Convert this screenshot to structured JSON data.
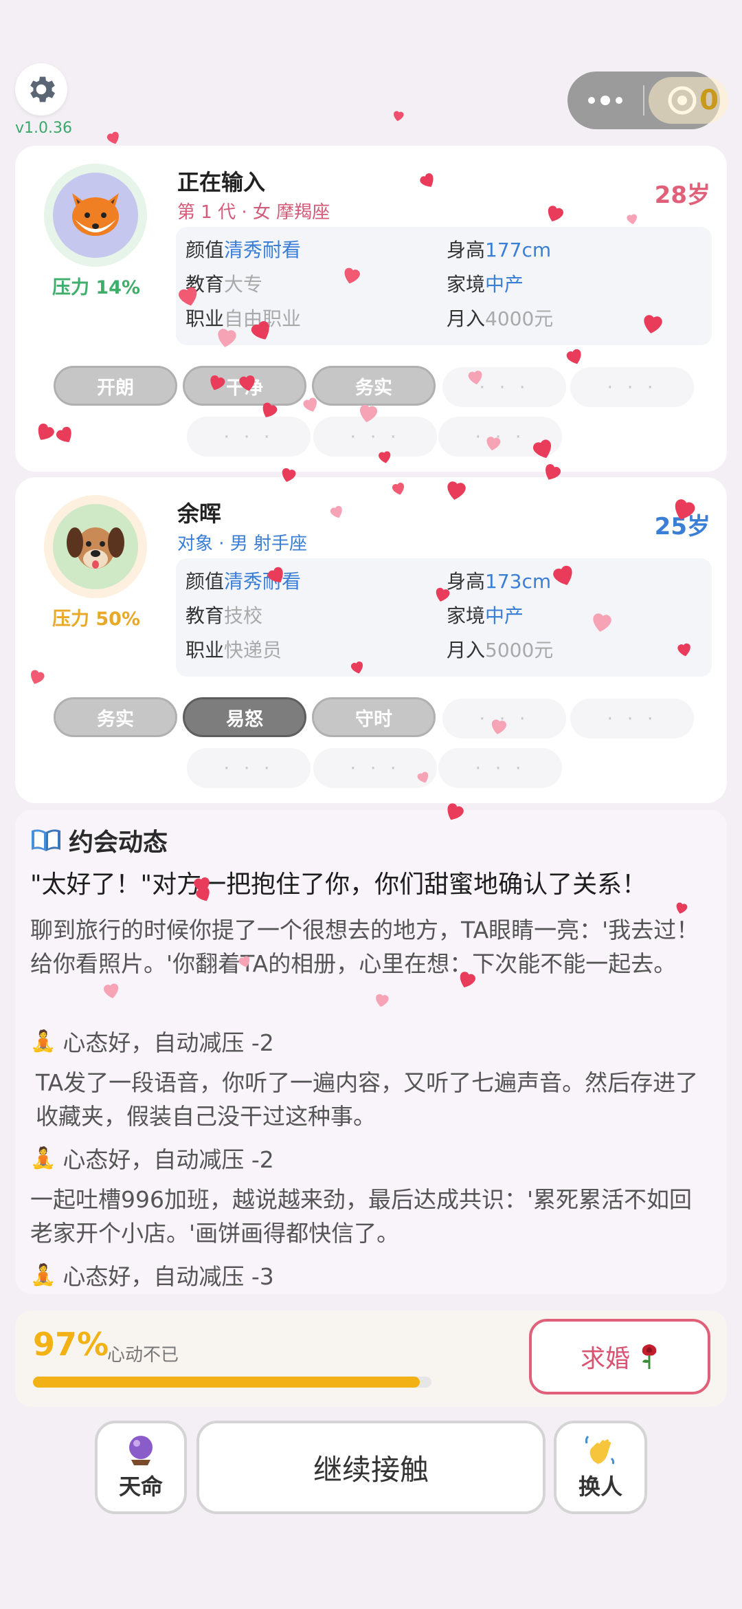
{
  "app": {
    "version": "v1.0.36",
    "coin_value": "0"
  },
  "self": {
    "name": "正在输入",
    "subtitle": "第 1 代 · 女 摩羯座",
    "age": "28岁",
    "pressure": "压力 14%",
    "avatar": "fox-avatar",
    "info": {
      "looks_label": "颜值",
      "looks": "清秀耐看",
      "height_label": "身高",
      "height": "177cm",
      "edu_label": "教育",
      "edu": "大专",
      "family_label": "家境",
      "family": "中产",
      "job_label": "职业",
      "job": "自由职业",
      "income_label": "月入",
      "income": "4000元"
    },
    "tags": [
      "开朗",
      "干净",
      "务实"
    ],
    "empty_tag": "· · ·"
  },
  "partner": {
    "name": "余晖",
    "subtitle": "对象 · 男 射手座",
    "age": "25岁",
    "pressure": "压力 50%",
    "avatar": "dog-avatar",
    "info": {
      "looks_label": "颜值",
      "looks": "清秀耐看",
      "height_label": "身高",
      "height": "173cm",
      "edu_label": "教育",
      "edu": "技校",
      "family_label": "家境",
      "family": "中产",
      "job_label": "职业",
      "job": "快递员",
      "income_label": "月入",
      "income": "5000元"
    },
    "tags": [
      "务实",
      "易怒",
      "守时"
    ],
    "empty_tag": "· · ·"
  },
  "log": {
    "title": "约会动态",
    "main": "\"太好了！\"对方一把抱住了你，你们甜蜜地确认了关系！",
    "entries": [
      "聊到旅行的时候你提了一个很想去的地方，TA眼睛一亮：'我去过！给你看照片。'你翻着TA的相册，心里在想：下次能不能一起去。",
      "TA发了一段语音，你听了一遍内容，又听了七遍声音。然后存进了收藏夹，假装自己没干过这种事。",
      "一起吐槽996加班，越说越来劲，最后达成共识：'累死累活不如回老家开个小店。'画饼画得都快信了。"
    ],
    "notes": [
      "心态好，自动减压 -2",
      "心态好，自动减压 -2",
      "心态好，自动减压 -3"
    ]
  },
  "progress": {
    "percent_text": "97%",
    "percent": 97,
    "label": "心动不已",
    "propose_label": "求婚"
  },
  "actions": {
    "fate_label": "天命",
    "continue_label": "继续接触",
    "swap_label": "换人"
  },
  "colors": {
    "accent_pink": "#d95473",
    "gold": "#f2b216",
    "blue": "#3a7ed6",
    "green": "#3aa86b"
  }
}
